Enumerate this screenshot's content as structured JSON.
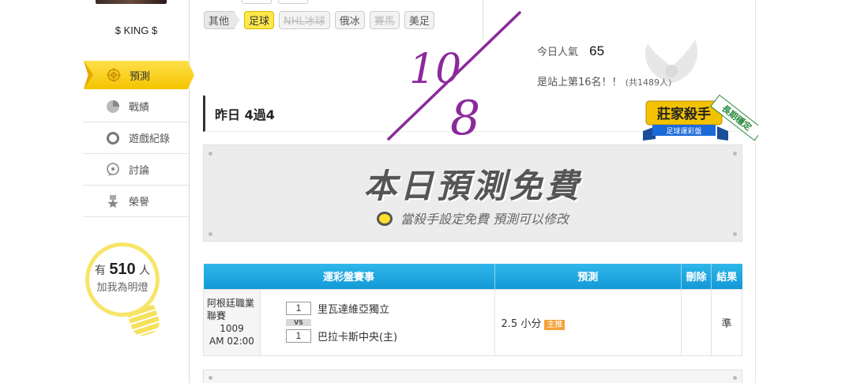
{
  "sidebar": {
    "username": "$ KING $",
    "items": [
      {
        "label": "預測",
        "icon": "target-icon",
        "active": true
      },
      {
        "label": "戰績",
        "icon": "chart-icon"
      },
      {
        "label": "遊戲紀錄",
        "icon": "ring-icon"
      },
      {
        "label": "討論",
        "icon": "discussion-icon"
      },
      {
        "label": "榮譽",
        "icon": "medal-icon"
      }
    ],
    "followers": {
      "prefix": "有",
      "count": "510",
      "suffix": "人",
      "text": "加我為明燈"
    }
  },
  "filters": [
    {
      "label": "其他"
    },
    {
      "label": "足球",
      "active": true
    },
    {
      "label": "NHL冰球",
      "disabled": true
    },
    {
      "label": "俄冰"
    },
    {
      "label": "賽馬",
      "disabled": true
    },
    {
      "label": "美足"
    }
  ],
  "stats": {
    "popularity_label": "今日人氣",
    "popularity_value": "65",
    "rank_text": "是站上第16名！！",
    "rank_total": "(共1489人)"
  },
  "badge": {
    "title": "莊家殺手",
    "subtitle": "足球運彩盤",
    "ribbon": "長期穩定"
  },
  "yesterday": "昨日 4過4",
  "free_panel": {
    "title": "本日預測免費",
    "subtitle": "當殺手設定免費  預測可以修改"
  },
  "table": {
    "headers": [
      "運彩盤賽事",
      "預測",
      "刪除",
      "結果"
    ],
    "rows": [
      {
        "league": "阿根廷職業聯賽",
        "code": "1009",
        "time": "AM 02:00",
        "team1_no": "1",
        "team1": "里瓦達維亞獨立",
        "vs": "VS",
        "team2_no": "1",
        "team2": "巴拉卡斯中央(主)",
        "prediction": "2.5 小分",
        "prediction_tag": "主推",
        "result": "準"
      }
    ]
  },
  "annotation": {
    "top": "10",
    "bottom": "8"
  },
  "colors": {
    "accent_yellow": "#ffe04a",
    "table_header": "#1fa9e2",
    "result_green": "#2e9a3a"
  }
}
